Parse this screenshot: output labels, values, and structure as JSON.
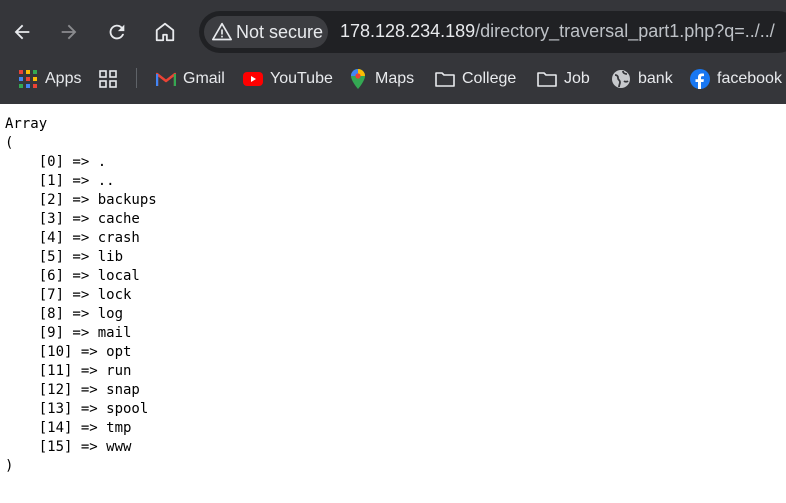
{
  "browser": {
    "security_label": "Not secure",
    "url_host": "178.128.234.189",
    "url_rest": "/directory_traversal_part1.php?q=../../"
  },
  "bookmarks": [
    {
      "label": "Apps",
      "icon": "apps-grid-icon"
    },
    {
      "label": "",
      "icon": "tab-groups-icon"
    },
    {
      "label": "Gmail",
      "icon": "gmail-icon"
    },
    {
      "label": "YouTube",
      "icon": "youtube-icon"
    },
    {
      "label": "Maps",
      "icon": "maps-icon"
    },
    {
      "label": "College",
      "icon": "folder-icon"
    },
    {
      "label": "Job",
      "icon": "folder-icon"
    },
    {
      "label": "bank",
      "icon": "globe-icon"
    },
    {
      "label": "facebook",
      "icon": "facebook-icon"
    }
  ],
  "output": {
    "lines": [
      "Array",
      "(",
      "    [0] => .",
      "    [1] => ..",
      "    [2] => backups",
      "    [3] => cache",
      "    [4] => crash",
      "    [5] => lib",
      "    [6] => local",
      "    [7] => lock",
      "    [8] => log",
      "    [9] => mail",
      "    [10] => opt",
      "    [11] => run",
      "    [12] => snap",
      "    [13] => spool",
      "    [14] => tmp",
      "    [15] => www",
      ")"
    ]
  },
  "colors": {
    "toolbar": "#35363a",
    "omnibox": "#202124",
    "text": "#e8eaed"
  }
}
